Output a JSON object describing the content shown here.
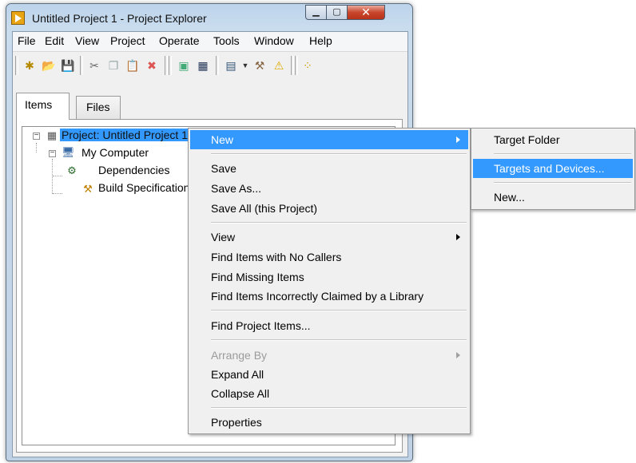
{
  "window": {
    "title": "Untitled Project 1 - Project Explorer",
    "min_label": "▁",
    "max_label": "▢",
    "close_label": "✕"
  },
  "menubar": [
    "File",
    "Edit",
    "View",
    "Project",
    "Operate",
    "Tools",
    "Window",
    "Help"
  ],
  "toolbar": {
    "icons": [
      "new-file-icon",
      "open-folder-icon",
      "save-all-icon",
      "cut-icon",
      "copy-icon",
      "paste-icon",
      "delete-icon",
      "add-file-icon",
      "save-project-icon",
      "view-options-icon",
      "dropdown-arrow-icon",
      "build-icon",
      "warning-icon",
      "source-control-icon"
    ]
  },
  "tabs": {
    "items": "Items",
    "files": "Files"
  },
  "tree": {
    "project": "Project: Untitled Project 1",
    "computer": "My Computer",
    "dependencies": "Dependencies",
    "build": "Build Specifications"
  },
  "context_menu": {
    "new": "New",
    "save": "Save",
    "save_as": "Save As...",
    "save_all": "Save All (this Project)",
    "view": "View",
    "find_no_callers": "Find Items with No Callers",
    "find_missing": "Find Missing Items",
    "find_incorrect": "Find Items Incorrectly Claimed by a Library",
    "find_project": "Find Project Items...",
    "arrange_by": "Arrange By",
    "expand_all": "Expand All",
    "collapse_all": "Collapse All",
    "properties": "Properties"
  },
  "submenu": {
    "target_folder": "Target Folder",
    "targets_devices": "Targets and Devices...",
    "new": "New..."
  },
  "colors": {
    "highlight": "#3399ff",
    "menu_bg": "#f0f0f0",
    "titlebar": "#bcd3ea"
  }
}
